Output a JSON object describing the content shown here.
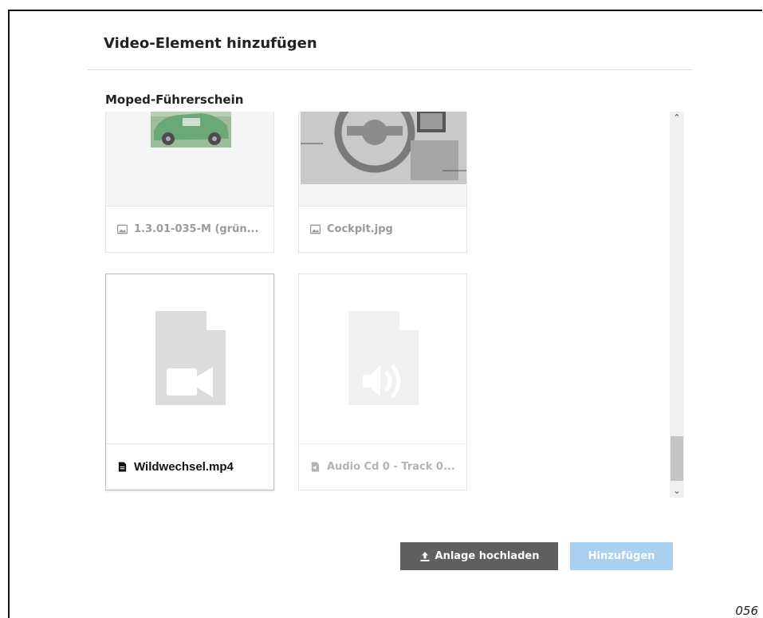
{
  "dialog": {
    "title": "Video-Element hinzufügen",
    "section_title": "Moped-Führerschein"
  },
  "files": [
    {
      "name": "1.3.01-035-M (grün...",
      "type": "image",
      "icon": "image-icon",
      "selected": false
    },
    {
      "name": "Cockpit.jpg",
      "type": "image",
      "icon": "image-icon",
      "selected": false
    },
    {
      "name": "Wildwechsel.mp4",
      "type": "video",
      "icon": "video-file-icon",
      "selected": true
    },
    {
      "name": "Audio Cd 0 - Track 0...",
      "type": "audio",
      "icon": "audio-file-icon",
      "selected": false
    }
  ],
  "buttons": {
    "upload": "Anlage hochladen",
    "add": "Hinzufügen"
  },
  "scrollbar": {
    "position": 0.92
  },
  "colors": {
    "upload_button": "#5f5f5f",
    "add_button": "#a9d0f1",
    "file_placeholder": "#dcdcdc"
  },
  "page_number": "056"
}
